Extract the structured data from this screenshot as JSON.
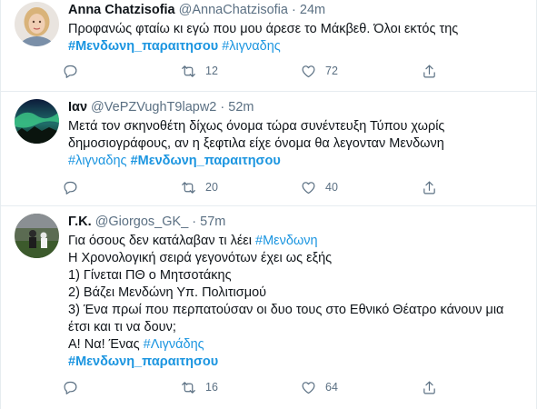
{
  "tweets": [
    {
      "name": "Anna Chatzisofia",
      "handle": "@AnnaChatzisofia",
      "dot": "·",
      "time": "24m",
      "lines": [
        [
          {
            "text": "Προφανώς φταίω κι εγώ που μου άρεσε το Μάκβεθ. Όλοι εκτός της",
            "kind": "text"
          }
        ],
        [
          {
            "text": "#Μενδωνη_παραιτησου",
            "kind": "tag-bold"
          },
          {
            "text": " ",
            "kind": "text"
          },
          {
            "text": "#λιγναδης",
            "kind": "tag"
          }
        ]
      ],
      "replies": "",
      "retweets": "12",
      "likes": "72"
    },
    {
      "name": "Ιαν",
      "handle": "@VePZVughT9lapw2",
      "dot": "·",
      "time": "52m",
      "lines": [
        [
          {
            "text": "Μετά τον σκηνοθέτη δίχως όνομα τώρα συνέντευξη Τύπου χωρίς",
            "kind": "text"
          }
        ],
        [
          {
            "text": "δημοσιογράφους, αν η ξεφτιλα είχε όνομα θα λεγονταν Μενδωνη",
            "kind": "text"
          }
        ],
        [
          {
            "text": "#λιγναδης",
            "kind": "tag"
          },
          {
            "text": " ",
            "kind": "text"
          },
          {
            "text": "#Μενδωνη_παραιτησου",
            "kind": "tag-bold"
          }
        ]
      ],
      "replies": "",
      "retweets": "20",
      "likes": "40"
    },
    {
      "name": "Γ.Κ.",
      "handle": "@Giorgos_GK_",
      "dot": "·",
      "time": "57m",
      "lines": [
        [
          {
            "text": "Για όσους δεν κατάλαβαν τι λέει ",
            "kind": "text"
          },
          {
            "text": "#Μενδωνη",
            "kind": "tag"
          }
        ],
        [
          {
            "text": "Η Χρονολογική σειρά γεγονότων έχει ως εξής",
            "kind": "text"
          }
        ],
        [
          {
            "text": "1) Γίνεται ΠΘ ο Μητσοτάκης",
            "kind": "text"
          }
        ],
        [
          {
            "text": "2) Βάζει Μενδώνη Υπ. Πολιτισμού",
            "kind": "text"
          }
        ],
        [
          {
            "text": "3) Ένα πρωί που περπατούσαν οι δυο τους στο Εθνικό Θέατρο κάνουν μια",
            "kind": "text"
          }
        ],
        [
          {
            "text": "έτσι και τι να δουν;",
            "kind": "text"
          }
        ],
        [
          {
            "text": "Α! Να! Ένας ",
            "kind": "text"
          },
          {
            "text": "#Λιγνάδης",
            "kind": "tag"
          }
        ],
        [
          {
            "text": "#Μενδωνη_παραιτησου",
            "kind": "tag-bold"
          }
        ]
      ],
      "replies": "",
      "retweets": "16",
      "likes": "64"
    }
  ],
  "icons": {
    "reply": "reply-icon",
    "retweet": "retweet-icon",
    "like": "like-icon",
    "share": "share-icon"
  },
  "colors": {
    "hashtag": "#1b95e0",
    "muted": "#5b7083",
    "divider": "#e6ecf0"
  }
}
